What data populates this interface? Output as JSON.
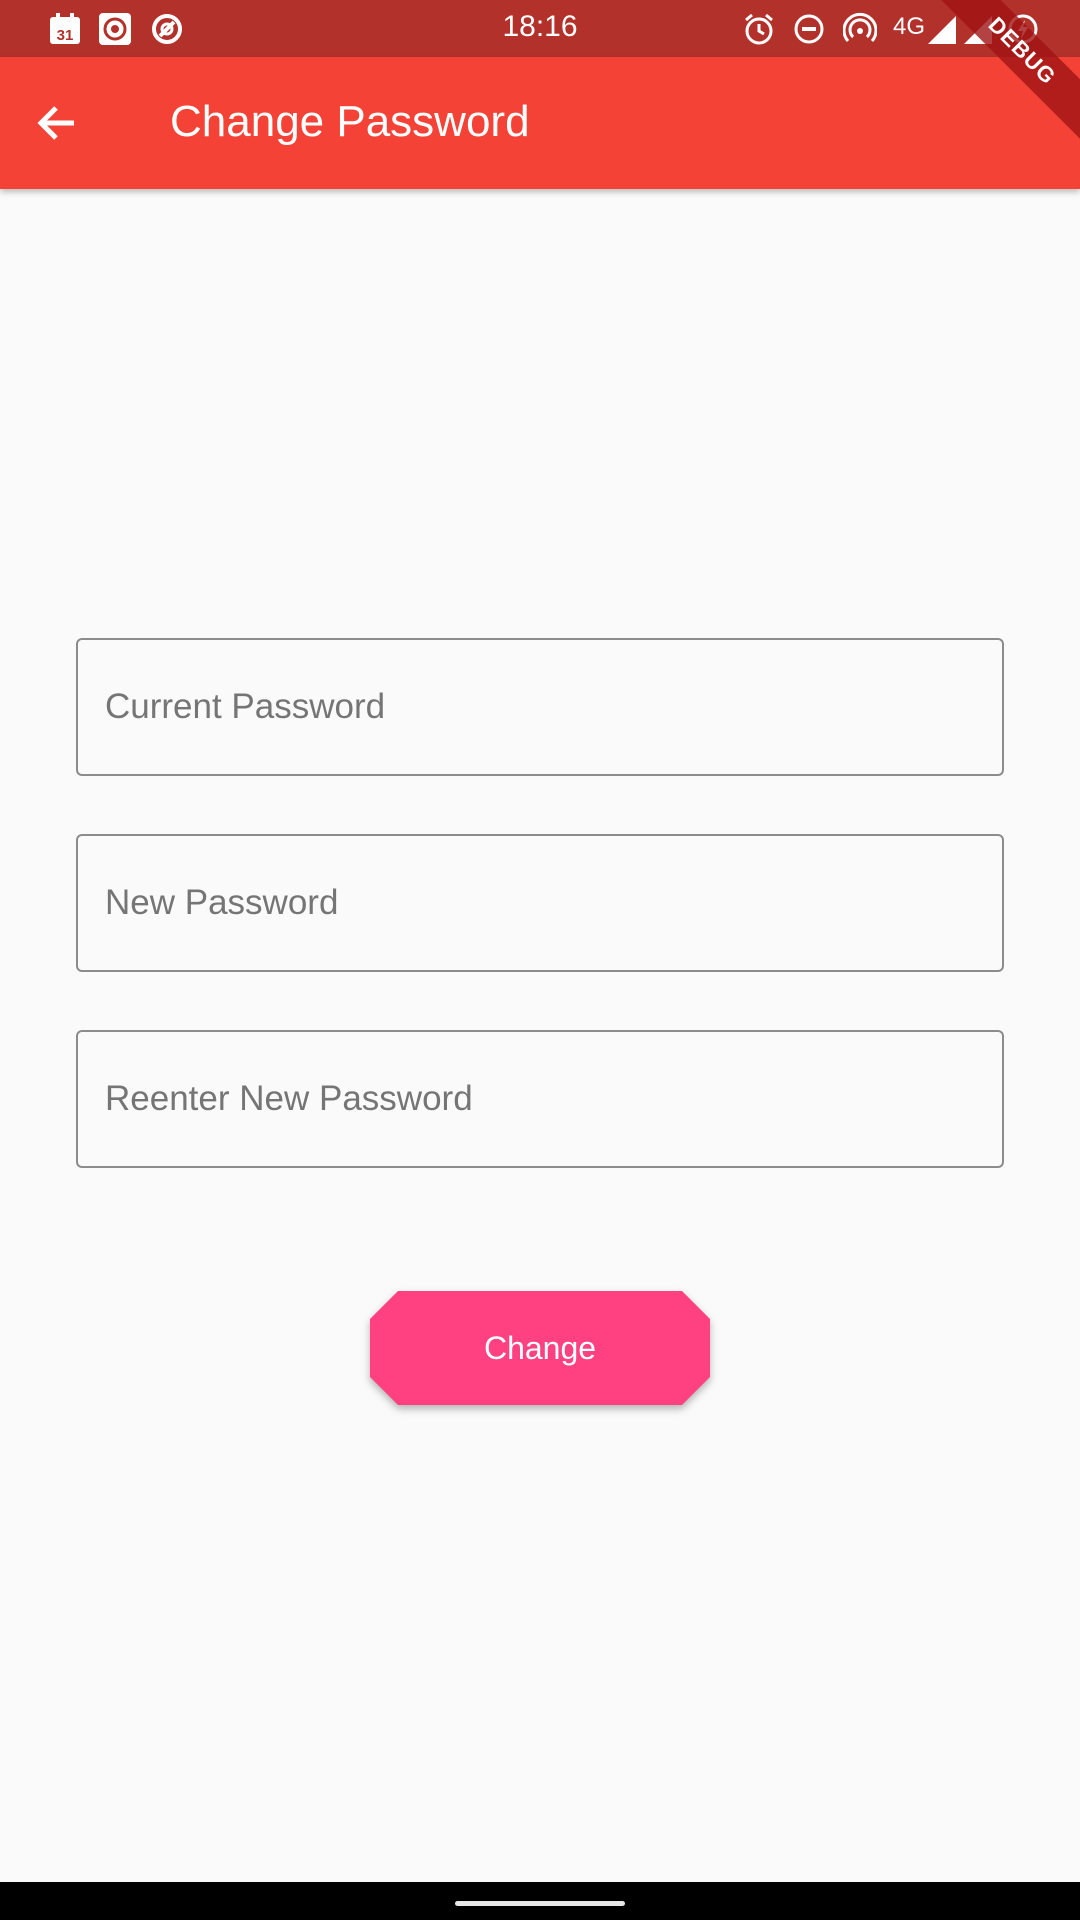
{
  "status_bar": {
    "time": "18:16",
    "network": "4G",
    "left_icons": [
      "calendar-icon",
      "record-icon",
      "sync-icon"
    ],
    "right_icons": [
      "alarm-icon",
      "dnd-icon",
      "hotspot-icon",
      "signal-icon",
      "signal-icon",
      "battery-icon"
    ],
    "calendar_day": "31"
  },
  "app_bar": {
    "title": "Change Password",
    "back_icon": "arrow-back-icon",
    "color": "#f44336"
  },
  "debug_banner": "DEBUG",
  "form": {
    "current_password": {
      "placeholder": "Current Password",
      "value": ""
    },
    "new_password": {
      "placeholder": "New Password",
      "value": ""
    },
    "reenter_password": {
      "placeholder": "Reenter New Password",
      "value": ""
    }
  },
  "submit_button": {
    "label": "Change",
    "color": "#ff4081"
  }
}
